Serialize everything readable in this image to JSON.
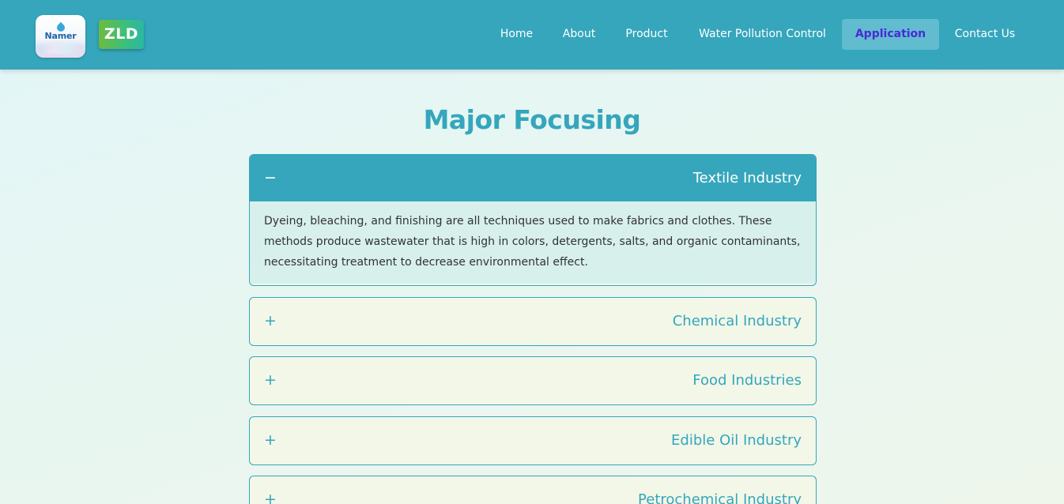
{
  "header": {
    "logo_namer_text": "Namer",
    "logo_zld_text": "ZLD",
    "nav": [
      {
        "label": "Home"
      },
      {
        "label": "About"
      },
      {
        "label": "Product"
      },
      {
        "label": "Water Pollution Control"
      },
      {
        "label": "Application",
        "active": true
      },
      {
        "label": "Contact Us"
      }
    ]
  },
  "main": {
    "title": "Major Focusing",
    "accordion": [
      {
        "title": "Textile Industry",
        "toggle": "−",
        "expanded": true,
        "body": "Dyeing, bleaching, and finishing are all techniques used to make fabrics and clothes. These methods produce wastewater that is high in colors, detergents, salts, and organic contaminants, necessitating treatment to decrease environmental effect."
      },
      {
        "title": "Chemical Industry",
        "toggle": "+",
        "expanded": false
      },
      {
        "title": "Food Industries",
        "toggle": "+",
        "expanded": false
      },
      {
        "title": "Edible Oil Industry",
        "toggle": "+",
        "expanded": false
      },
      {
        "title": "Petrochemical Industry",
        "toggle": "+",
        "expanded": false
      }
    ]
  },
  "colors": {
    "primary": "#35a6bc",
    "active_nav_text": "#4a2ad6",
    "panel_background": "#f2f7e8",
    "expanded_body": "#d7f0ec"
  }
}
